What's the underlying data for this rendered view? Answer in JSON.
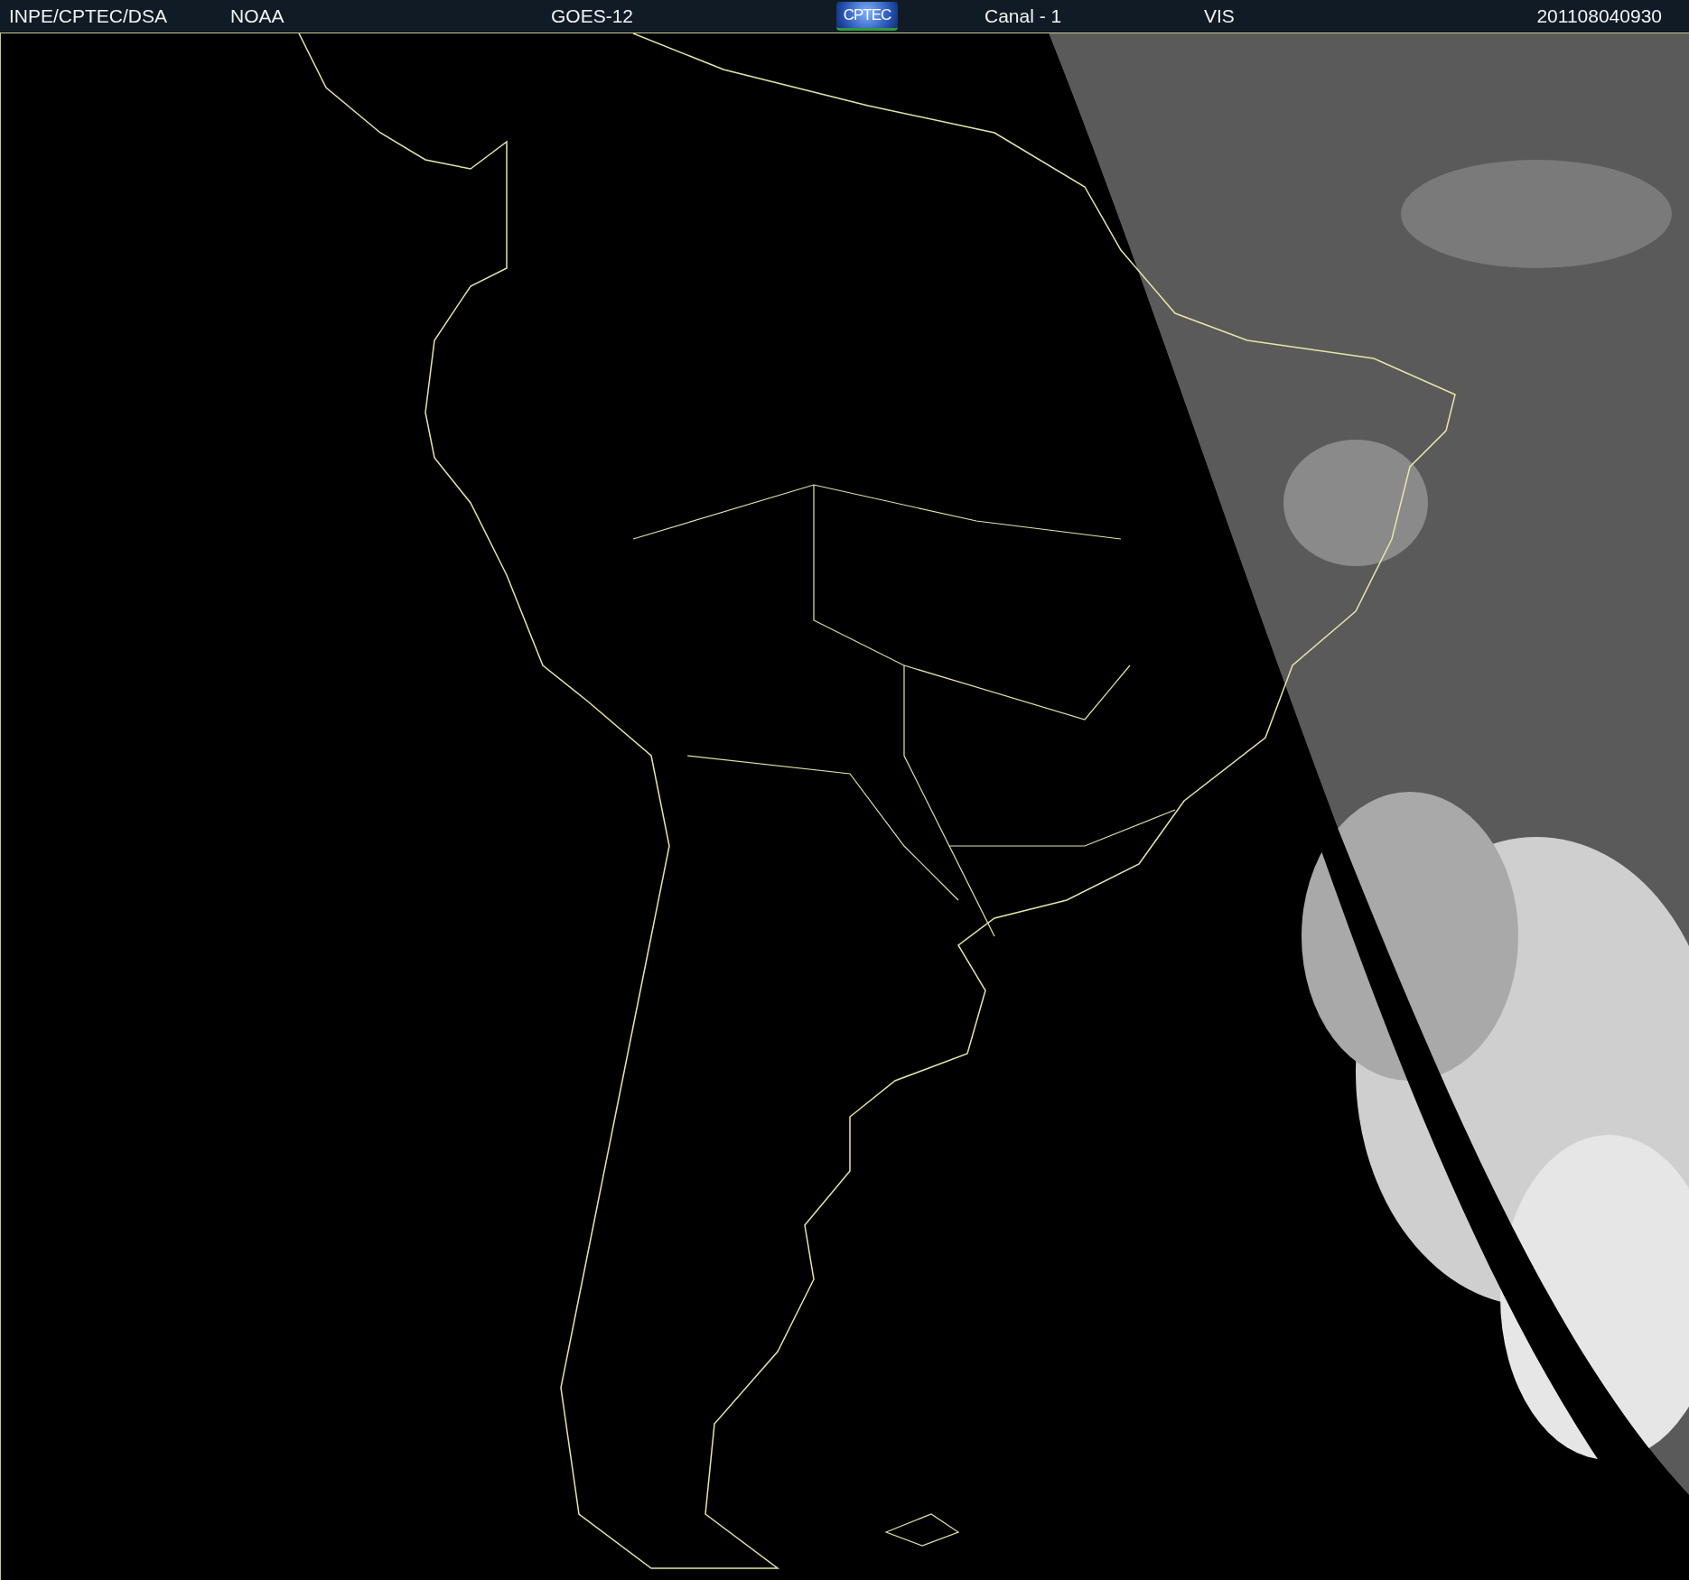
{
  "header": {
    "items": [
      {
        "kind": "text",
        "label": "INPE/CPTEC/DSA"
      },
      {
        "kind": "text",
        "label": "NOAA"
      },
      {
        "kind": "text",
        "label": "GOES-12"
      },
      {
        "kind": "logo",
        "label": "CPTEC"
      },
      {
        "kind": "text",
        "label": "Canal - 1"
      },
      {
        "kind": "text",
        "label": "VIS"
      },
      {
        "kind": "text",
        "label": "201108040930"
      }
    ]
  }
}
